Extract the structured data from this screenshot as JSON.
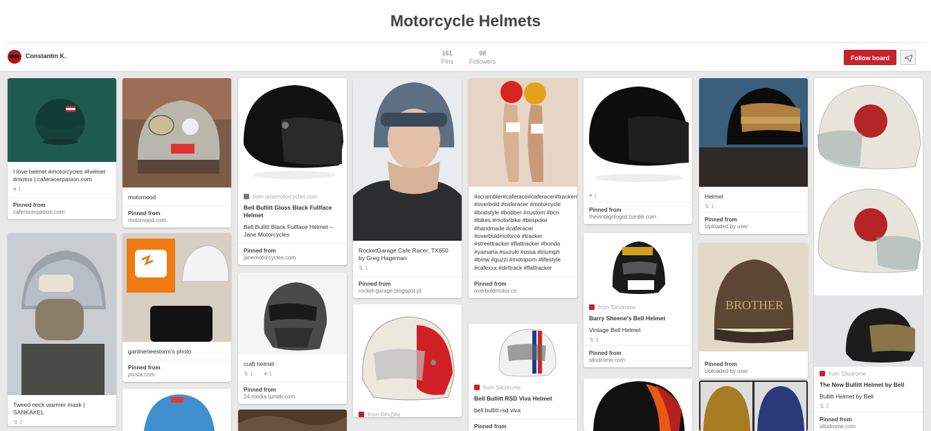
{
  "board": {
    "title": "Motorcycle Helmets",
    "owner": "Constantin K.",
    "pins_count": "161",
    "pins_label": "Pins",
    "followers_count": "98",
    "followers_label": "Followers",
    "follow_label": "Follow board"
  },
  "colors": {
    "accent": "#c8232c",
    "background": "#e9e9e9"
  },
  "pins": {
    "p1": {
      "desc": "I love helmet #motorcycles #helmet #motos | caferacerpasion.com",
      "likes": "1",
      "from_label": "Pinned from",
      "from": "caferacerpasion.com"
    },
    "p2": {
      "desc": "Tweed neck warmer mask | SANKAKEL",
      "likes": "2"
    },
    "p3": {
      "desc": "motomood",
      "from_label": "Pinned from",
      "from": "motomood.com"
    },
    "p4": {
      "desc": "gardnerleestorm's photo",
      "from_label": "Pinned from",
      "from": "pixsta.com"
    },
    "p5": {
      "source": "from janemotorcycles.com",
      "title": "Bell Bullitt Gloss Black Fullface Helmet",
      "desc": "Bell Bullitt Black Fullface Helmet – Jane Motorcycles",
      "from_label": "Pinned from",
      "from": "janemotorcycles.com"
    },
    "p6": {
      "desc": "craft helmet",
      "repins": "1",
      "likes": "1",
      "from_label": "Pinned from",
      "from": "24.media.tumblr.com"
    },
    "p7": {
      "desc": "RocketGarage Cafe Racer: TX650 by Greg Hageman",
      "repins": "1",
      "from_label": "Pinned from",
      "from": "rocket-garage.blogspot.pt"
    },
    "p8": {
      "source": "from RevZilla"
    },
    "p9": {
      "desc": "#scrambler#caferace#caferacer#tracker#bobber#triumph#ducati#yamah... #overbold #caferacer #motorcycle #bratstyle #bobber #custom #bcn #bikes #motorbike #bespoke #handmade #caferacer #overboldmotorco #tracker #streettracker #flattracker #honda #yamaha #suzuki #ossa #triumph #bmw #guzzi #motoporn #lifestyle #cafexxx #dirttrack #flattracker",
      "from_label": "Pinned from",
      "from": "overboldmotor.co"
    },
    "p10": {
      "source": "from Silodrome",
      "title": "Bell Bullitt RSD Viva Helmet",
      "desc": "bell bullitt rsd viva",
      "from_label": "Pinned from"
    },
    "p11": {
      "likes": "1",
      "from_label": "Pinned from",
      "from": "thevintagologist.tumblr.com"
    },
    "p12": {
      "source": "from Silodrome",
      "title": "Barry Sheene's Bell Helmet",
      "desc": "Vintage Bell Helmet",
      "repins": "3",
      "from_label": "Pinned from",
      "from": "silodrome.com"
    },
    "p13": {
      "desc": "Helmet",
      "repins": "1",
      "from_label": "Pinned from",
      "from": "Uploaded by user"
    },
    "p14": {
      "from_label": "Pinned from",
      "from": "Uploaded by user",
      "img_text": "BROTHER"
    },
    "p15": {
      "source": "from Silodrome",
      "title": "The New Bullitt Helmet by Bell",
      "desc": "Bullitt Helmet by Bell",
      "repins": "2",
      "from_label": "Pinned from",
      "from": "silodrome.com"
    }
  }
}
